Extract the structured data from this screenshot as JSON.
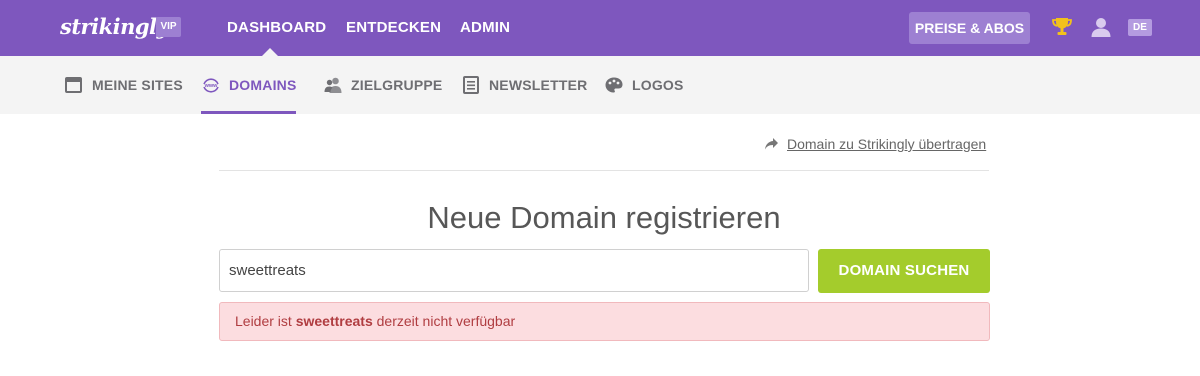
{
  "topbar": {
    "brand": "strikingly",
    "badge": "VIP",
    "nav": [
      {
        "label": "DASHBOARD"
      },
      {
        "label": "ENTDECKEN"
      },
      {
        "label": "ADMIN"
      }
    ],
    "pricing_label": "PREISE & ABOS",
    "language": "DE",
    "colors": {
      "bar": "#7e57be",
      "button": "#9d80d2"
    }
  },
  "subnav": {
    "items": [
      {
        "label": "MEINE SITES",
        "icon": "browser-window-icon"
      },
      {
        "label": "DOMAINS",
        "icon": "www-globe-icon",
        "active": true
      },
      {
        "label": "ZIELGRUPPE",
        "icon": "people-icon"
      },
      {
        "label": "NEWSLETTER",
        "icon": "newsletter-icon"
      },
      {
        "label": "LOGOS",
        "icon": "palette-icon"
      }
    ]
  },
  "content": {
    "transfer_link": "Domain zu Strikingly übertragen",
    "title": "Neue Domain registrieren",
    "search": {
      "value": "sweettreats",
      "button_label": "DOMAIN SUCHEN"
    },
    "alert": {
      "prefix": "Leider ist ",
      "domain": "sweettreats",
      "suffix": " derzeit nicht verfügbar"
    },
    "colors": {
      "search_button": "#a4cc2c",
      "alert_bg": "#fcdde0",
      "alert_text": "#b03d41"
    }
  }
}
